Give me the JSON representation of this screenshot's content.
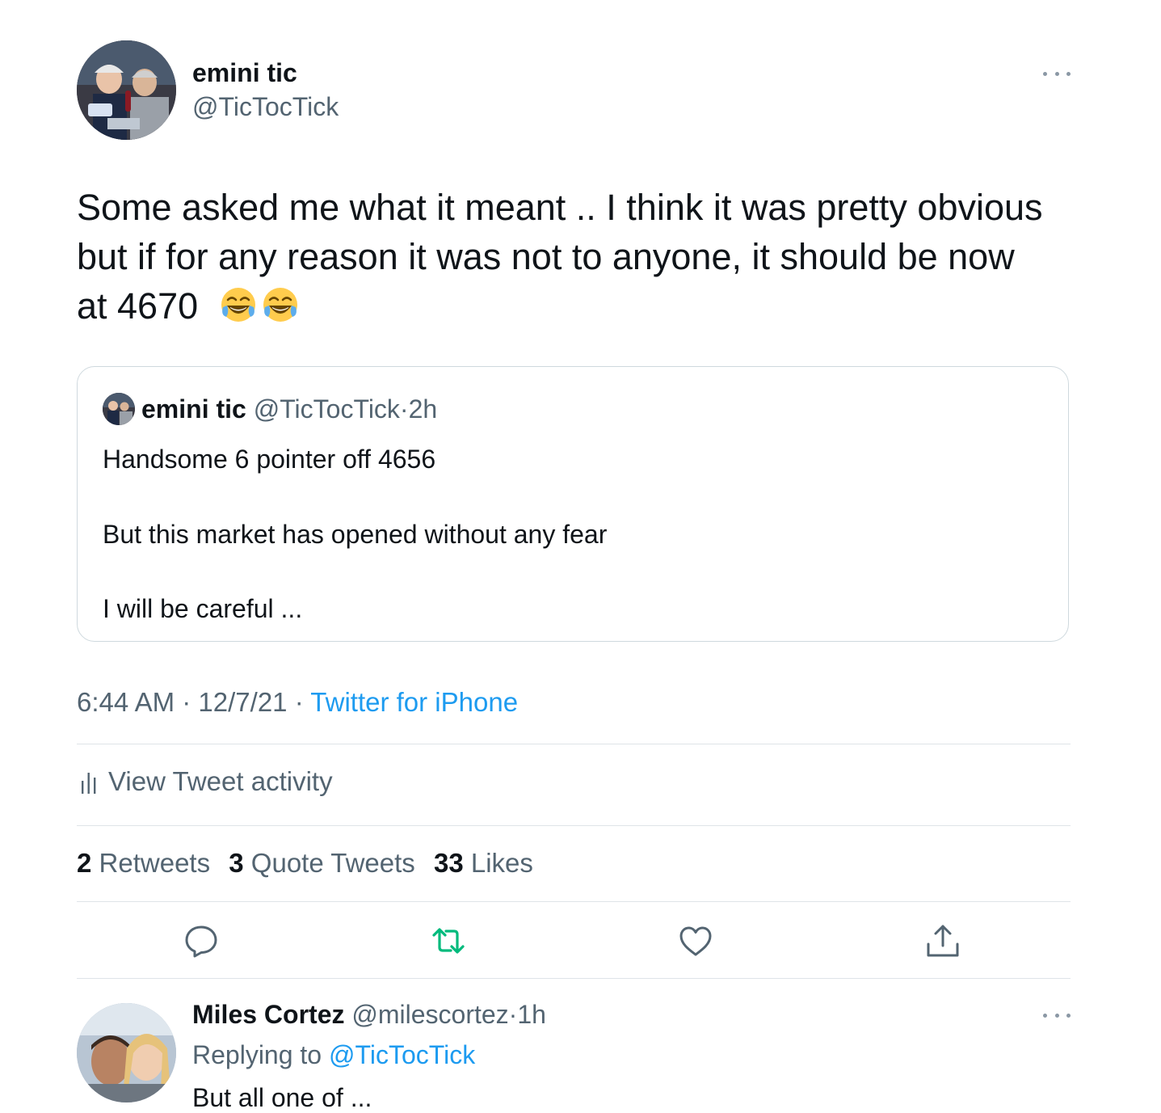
{
  "tweet": {
    "author": {
      "name": "emini tic",
      "handle": "@TicTocTick"
    },
    "text_lines": [
      "Some asked me what it meant .. I think it was pretty obvious",
      "but if for any reason it was not to anyone, it should be now",
      "at 4670"
    ],
    "emojis": [
      "face-with-tears-of-joy-icon",
      "face-with-tears-of-joy-icon"
    ],
    "quote": {
      "name": "emini tic",
      "handle": "@TicTocTick",
      "separator": "·",
      "time": "2h",
      "lines": [
        "Handsome 6 pointer off 4656",
        "But this market has opened without any fear",
        "I will be careful ..."
      ]
    },
    "meta": {
      "time": "6:44 AM",
      "separator": "·",
      "date": "12/7/21",
      "source": "Twitter for iPhone"
    },
    "activity_label": "View Tweet activity",
    "stats": {
      "retweets_count": "2",
      "retweets_label": "Retweets",
      "quotes_count": "3",
      "quotes_label": "Quote Tweets",
      "likes_count": "33",
      "likes_label": "Likes"
    },
    "actions": [
      "reply-icon",
      "retweet-icon",
      "like-icon",
      "share-icon"
    ],
    "colors": {
      "accent": "#1d9bf0",
      "retweet_active": "#00ba7c",
      "secondary_text": "#536471",
      "primary_text": "#0f1419",
      "border": "#cfd9de"
    }
  },
  "reply": {
    "name": "Miles Cortez",
    "handle": "@milescortez",
    "separator": "·",
    "time": "1h",
    "replying_prefix": "Replying to",
    "replying_to": "@TicTocTick",
    "text_partial": "But all one of ..."
  }
}
